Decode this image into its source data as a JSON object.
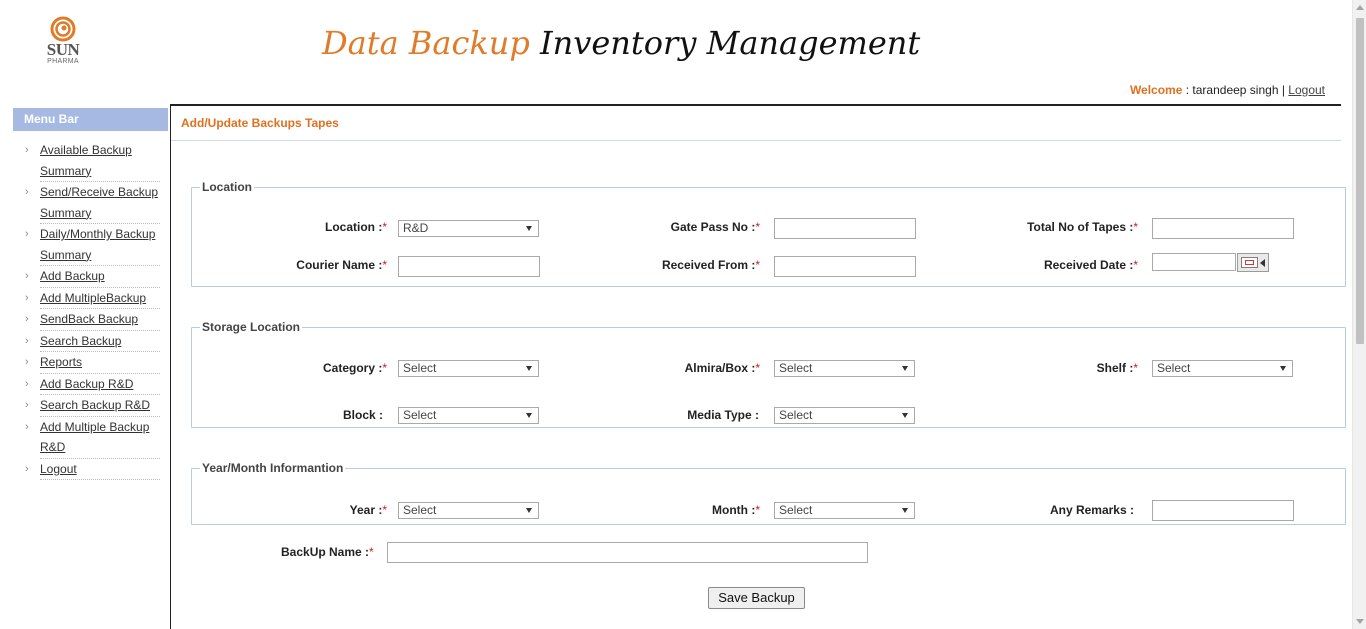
{
  "header": {
    "logo": {
      "name": "SUN",
      "sub": "PHARMA"
    },
    "title_part1": "Data Backup",
    "title_part2": "Inventory Management",
    "welcome_label": "Welcome",
    "welcome_sep": " : ",
    "user_name": "tarandeep singh",
    "divider": " | ",
    "logout_label": "Logout"
  },
  "sidebar": {
    "heading": "Menu Bar",
    "items": [
      {
        "label": "Available Backup Summary"
      },
      {
        "label": "Send/Receive Backup Summary"
      },
      {
        "label": "Daily/Monthly Backup Summary"
      },
      {
        "label": "Add Backup"
      },
      {
        "label": "Add MultipleBackup"
      },
      {
        "label": "SendBack Backup"
      },
      {
        "label": "Search Backup"
      },
      {
        "label": "Reports"
      },
      {
        "label": "Add Backup R&D"
      },
      {
        "label": "Search Backup R&D"
      },
      {
        "label": "Add Multiple Backup R&D"
      },
      {
        "label": "Logout"
      }
    ]
  },
  "form": {
    "title": "Add/Update Backups Tapes",
    "location_group": {
      "legend": "Location",
      "location_label": "Location :",
      "location_value": "R&D",
      "gatepass_label": "Gate Pass No :",
      "gatepass_value": "",
      "tapes_label": "Total No of Tapes :",
      "tapes_value": "",
      "courier_label": "Courier Name :",
      "courier_value": "",
      "received_from_label": "Received From :",
      "received_from_value": "",
      "received_date_label": "Received Date :",
      "received_date_value": ""
    },
    "storage_group": {
      "legend": "Storage Location",
      "category_label": "Category :",
      "category_value": "Select",
      "almira_label": "Almira/Box :",
      "almira_value": "Select",
      "shelf_label": "Shelf :",
      "shelf_value": "Select",
      "block_label": "Block :",
      "block_value": "Select",
      "media_label": "Media Type :",
      "media_value": "Select"
    },
    "year_group": {
      "legend": "Year/Month Informantion",
      "year_label": "Year :",
      "year_value": "Select",
      "month_label": "Month :",
      "month_value": "Select",
      "remarks_label": "Any Remarks :",
      "remarks_value": ""
    },
    "backup_name_label": "BackUp Name :",
    "backup_name_value": "",
    "required_mark": "*",
    "save_label": "Save Backup"
  }
}
